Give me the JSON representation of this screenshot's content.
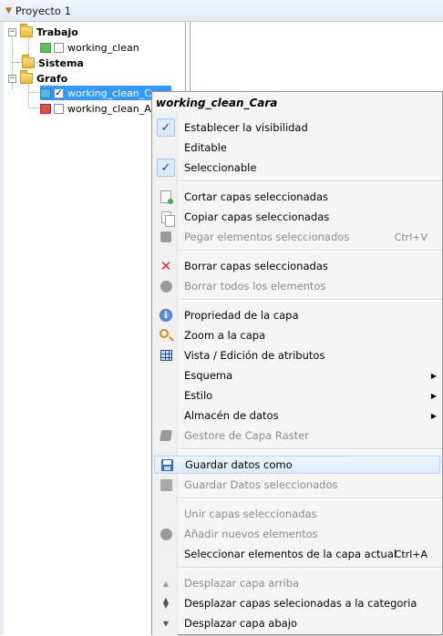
{
  "window": {
    "title": "Proyecto 1"
  },
  "tree": {
    "groups": [
      {
        "label": "Trabajo",
        "layers": [
          {
            "label": "working_clean",
            "color": "#5bc35b",
            "checked": false
          }
        ]
      },
      {
        "label": "Sistema",
        "layers": []
      },
      {
        "label": "Grafo",
        "layers": [
          {
            "label": "working_clean_Cara",
            "color": "#5ab8d6",
            "checked": true,
            "selected": true
          },
          {
            "label": "working_clean_Aris",
            "color": "#d94f4f",
            "checked": false
          }
        ]
      }
    ]
  },
  "menu": {
    "header": "working_clean_Cara",
    "items": [
      {
        "label": "Establecer la visibilidad",
        "icon": "check-icon",
        "checked": true
      },
      {
        "label": "Editable",
        "icon": "none"
      },
      {
        "label": "Seleccionable",
        "icon": "check-icon",
        "checked": true
      },
      {
        "label": "Cortar capas seleccionadas",
        "icon": "cut-page-icon"
      },
      {
        "label": "Copiar capas seleccionadas",
        "icon": "copy-icon"
      },
      {
        "label": "Pegar elementos seleccionados",
        "icon": "paste-icon",
        "disabled": true,
        "shortcut": "Ctrl+V"
      },
      {
        "label": "Borrar capas seleccionadas",
        "icon": "delete-x-icon"
      },
      {
        "label": "Borrar todos los elementos",
        "icon": "clear-circle-icon",
        "disabled": true
      },
      {
        "label": "Propriedad de la capa",
        "icon": "info-icon"
      },
      {
        "label": "Zoom a la capa",
        "icon": "zoom-icon"
      },
      {
        "label": "Vista / Edición de atributos",
        "icon": "table-icon"
      },
      {
        "label": "Esquema",
        "submenu": true
      },
      {
        "label": "Estilo",
        "submenu": true
      },
      {
        "label": "Almacén de datos",
        "submenu": true
      },
      {
        "label": "Gestore de Capa Raster",
        "icon": "raster-icon",
        "disabled": true
      },
      {
        "label": "Guardar datos como",
        "icon": "save-icon",
        "highlighted": true
      },
      {
        "label": "Guardar Datos seleccionados",
        "icon": "save-selected-icon",
        "disabled": true
      },
      {
        "label": "Unir capas seleccionadas",
        "disabled": true
      },
      {
        "label": "Añadir nuevos elementos",
        "icon": "add-circle-icon",
        "disabled": true
      },
      {
        "label": "Seleccionar elementos de la capa actual",
        "shortcut": "Ctrl+A"
      },
      {
        "label": "Desplazar capa arriba",
        "icon": "move-up-icon",
        "disabled": true
      },
      {
        "label": "Desplazar capas selecionadas a la categoria",
        "icon": "move-to-category-icon"
      },
      {
        "label": "Desplazar capa abajo",
        "icon": "move-down-icon"
      }
    ]
  }
}
